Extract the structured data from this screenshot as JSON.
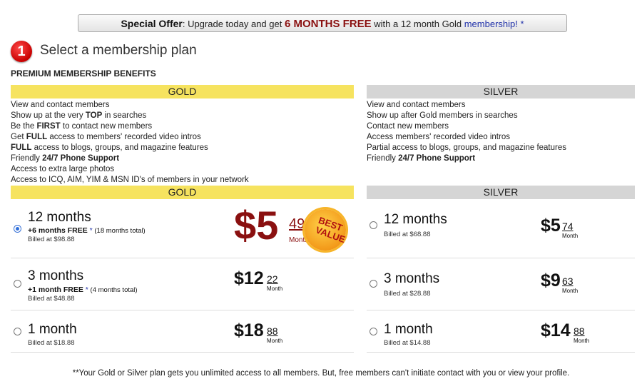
{
  "offer": {
    "label": "Special Offer",
    "text1": ": Upgrade today and get ",
    "highlight": "6 MONTHS FREE",
    "text2": " with a 12 month Gold ",
    "link": "membership!",
    "asterisk": " *"
  },
  "step": {
    "number": "1",
    "title": "Select a membership plan"
  },
  "benefits_title": "PREMIUM MEMBERSHIP BENEFITS",
  "gold": {
    "header": "GOLD",
    "benefits": [
      [
        "View and contact members",
        "",
        ""
      ],
      [
        "Show up at the very ",
        "TOP",
        " in searches"
      ],
      [
        "Be the ",
        "FIRST",
        " to contact new members"
      ],
      [
        "Get ",
        "FULL",
        " access to members' recorded video intros"
      ],
      [
        "",
        "FULL",
        " access to blogs, groups, and magazine features"
      ],
      [
        "Friendly ",
        "24/7 Phone Support",
        ""
      ],
      [
        "Access to extra large photos",
        "",
        ""
      ],
      [
        "Access to ICQ, AIM, YIM & MSN ID's of members in your network",
        "",
        ""
      ]
    ],
    "plans_header": "GOLD",
    "plans": [
      {
        "name": "12 months",
        "free": "+6 months FREE",
        "star": " *",
        "total": " (18 months total)",
        "billed": "Billed at $98.88",
        "dollars": "$5",
        "cents": "49",
        "per": "Month",
        "selected": true,
        "badge": "BEST VALUE"
      },
      {
        "name": "3 months",
        "free": "+1 month FREE",
        "star": " *",
        "total": " (4 months total)",
        "billed": "Billed at $48.88",
        "dollars": "$12",
        "cents": "22",
        "per": "Month",
        "selected": false
      },
      {
        "name": "1 month",
        "billed": "Billed at $18.88",
        "dollars": "$18",
        "cents": "88",
        "per": "Month",
        "selected": false
      }
    ]
  },
  "silver": {
    "header": "SILVER",
    "benefits": [
      [
        "View and contact members",
        "",
        ""
      ],
      [
        "Show up after Gold members in searches",
        "",
        ""
      ],
      [
        "Contact new members",
        "",
        ""
      ],
      [
        "Access members' recorded video intros",
        "",
        ""
      ],
      [
        "Partial access to blogs, groups, and magazine features",
        "",
        ""
      ],
      [
        "Friendly ",
        "24/7 Phone Support",
        ""
      ]
    ],
    "plans_header": "SILVER",
    "plans": [
      {
        "name": "12 months",
        "billed": "Billed at $68.88",
        "dollars": "$5",
        "cents": "74",
        "per": "Month",
        "selected": false
      },
      {
        "name": "3 months",
        "billed": "Billed at $28.88",
        "dollars": "$9",
        "cents": "63",
        "per": "Month",
        "selected": false
      },
      {
        "name": "1 month",
        "billed": "Billed at $14.88",
        "dollars": "$14",
        "cents": "88",
        "per": "Month",
        "selected": false
      }
    ]
  },
  "footnote": "**Your Gold or Silver plan gets you unlimited access to all members. But, free members can't initiate contact with you or view your profile.",
  "colors": {
    "gold_header": "#f6e35f",
    "silver_header": "#d5d5d5",
    "featured_price": "#8a1010",
    "accent_red": "#c80000"
  }
}
